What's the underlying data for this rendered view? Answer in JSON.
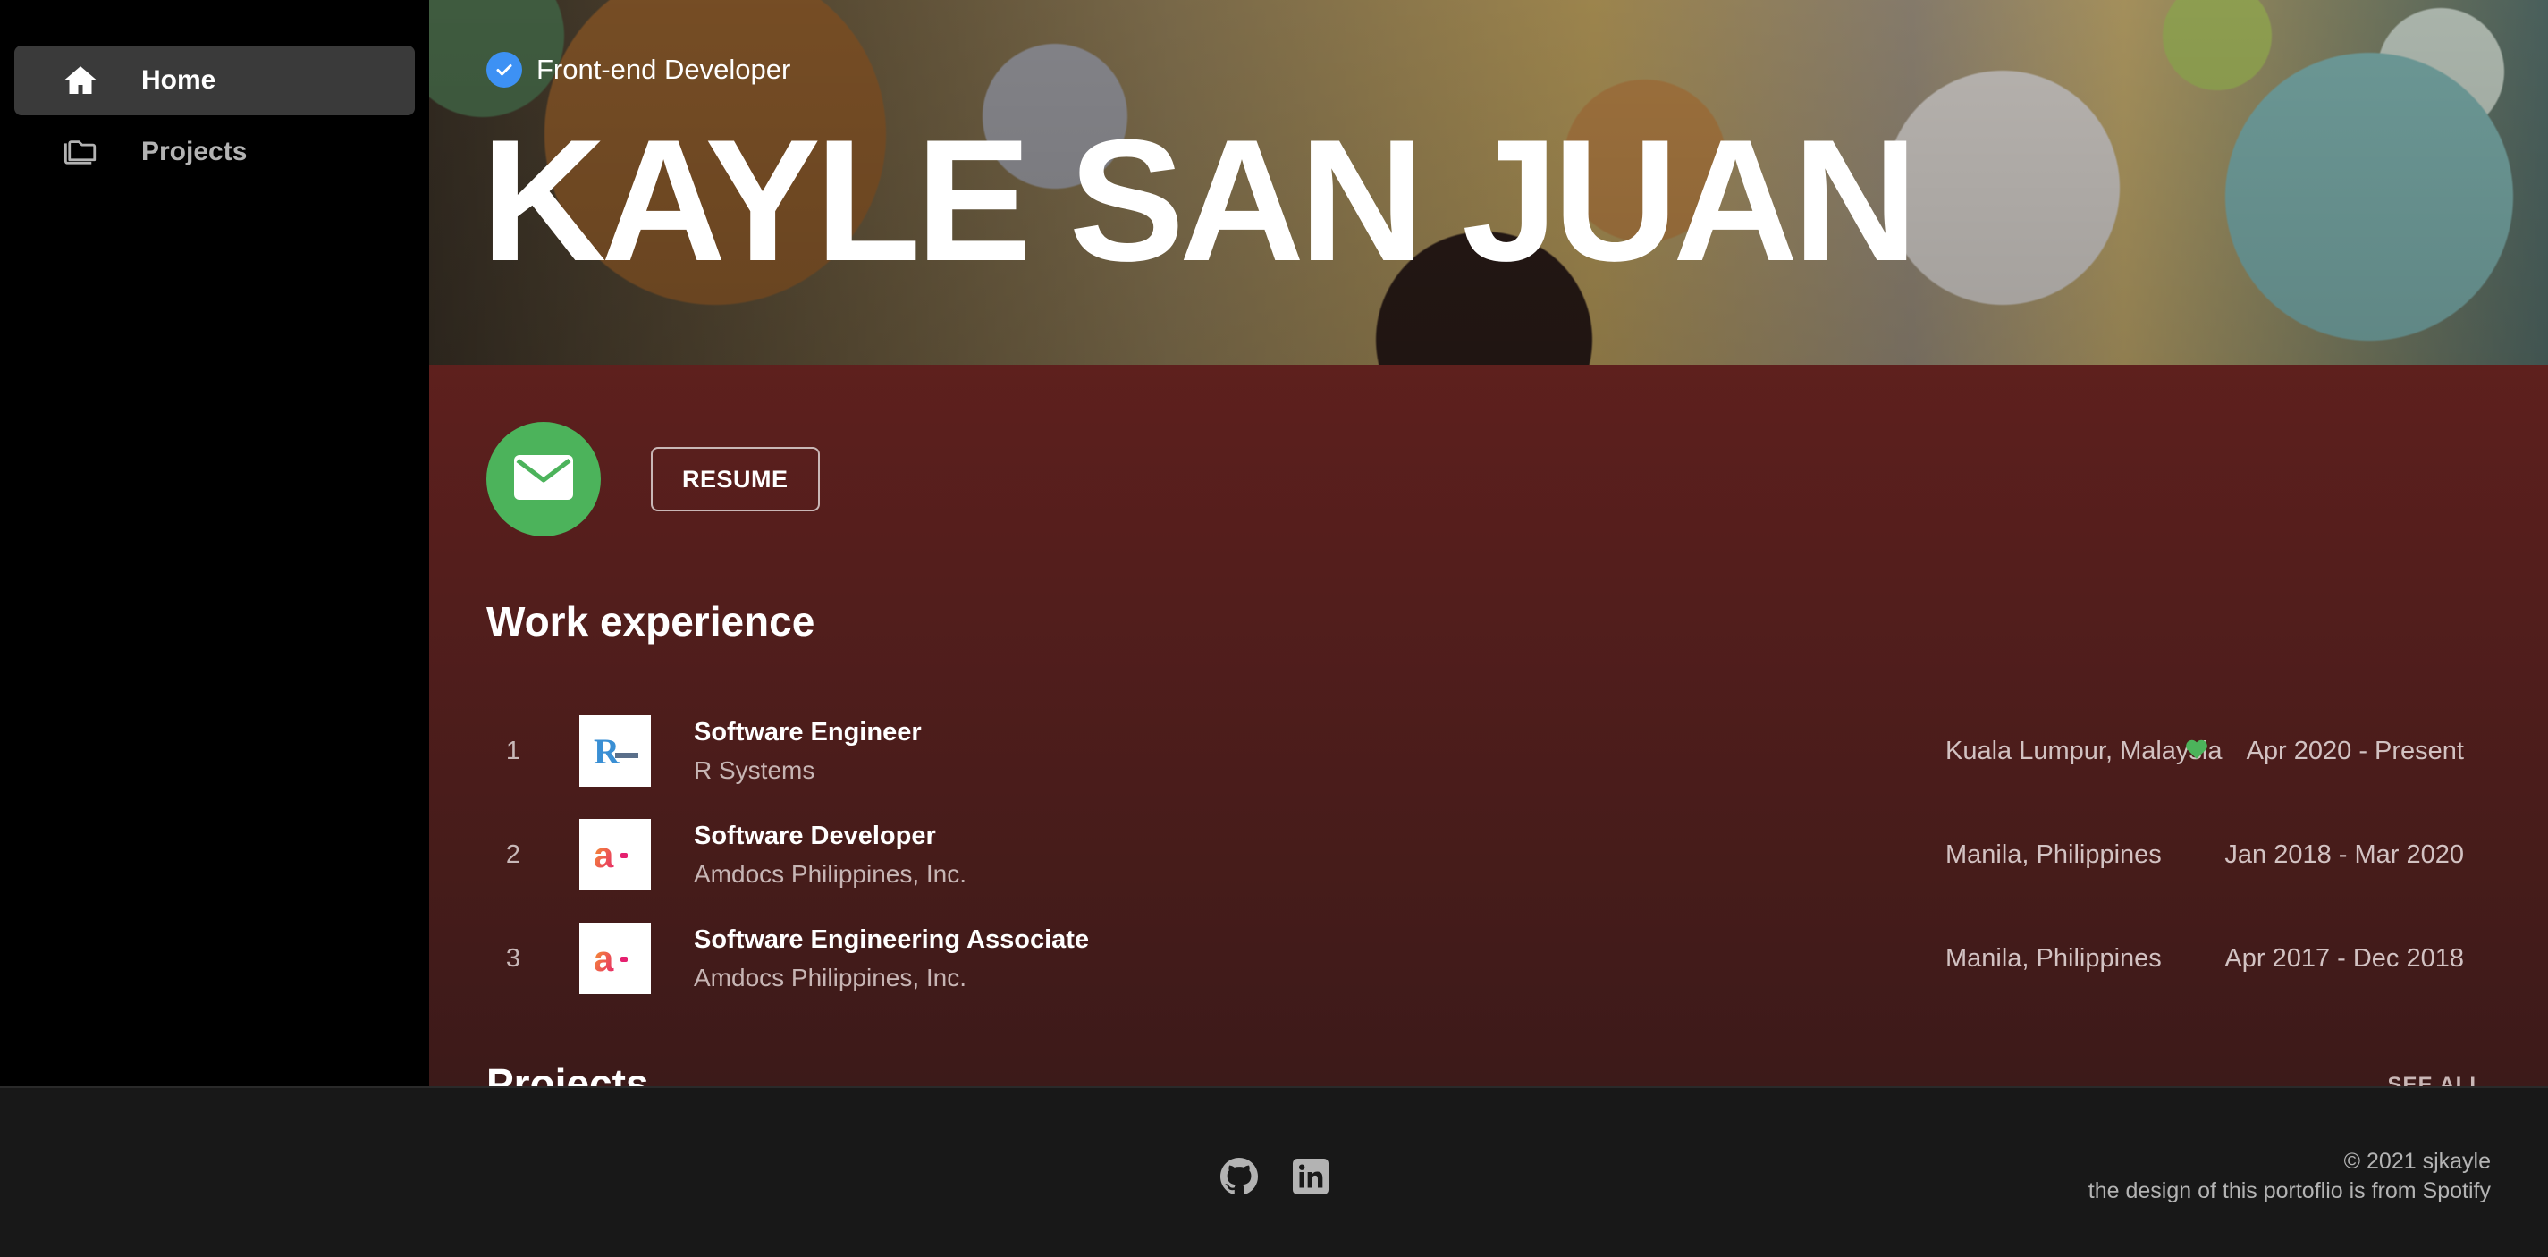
{
  "sidebar": {
    "items": [
      {
        "label": "Home",
        "icon": "home-icon",
        "active": true
      },
      {
        "label": "Projects",
        "icon": "folder-icon",
        "active": false
      }
    ]
  },
  "hero": {
    "badge_text": "Front-end Developer",
    "title": "KAYLE SAN JUAN"
  },
  "actions": {
    "mail_icon": "envelope-icon",
    "resume_label": "RESUME"
  },
  "work": {
    "title": "Work experience",
    "items": [
      {
        "num": "1",
        "role": "Software Engineer",
        "company": "R Systems",
        "location": "Kuala Lumpur, Malaysia",
        "dates": "Apr 2020 - Present",
        "current": true
      },
      {
        "num": "2",
        "role": "Software Developer",
        "company": "Amdocs Philippines, Inc.",
        "location": "Manila, Philippines",
        "dates": "Jan 2018 - Mar 2020",
        "current": false
      },
      {
        "num": "3",
        "role": "Software Engineering Associate",
        "company": "Amdocs Philippines, Inc.",
        "location": "Manila, Philippines",
        "dates": "Apr 2017 - Dec 2018",
        "current": false
      }
    ]
  },
  "projects": {
    "title": "Projects",
    "see_all": "SEE ALL"
  },
  "footer": {
    "copyright": "© 2021 sjkayle",
    "credit": "the design of this portoflio is from Spotify",
    "socials": [
      "github-icon",
      "linkedin-icon"
    ]
  },
  "colors": {
    "accent_green": "#4cb35b",
    "badge_blue": "#3d91f4",
    "main_bg_top": "#73231f",
    "sidebar_bg": "#000000",
    "footer_bg": "#181818"
  }
}
